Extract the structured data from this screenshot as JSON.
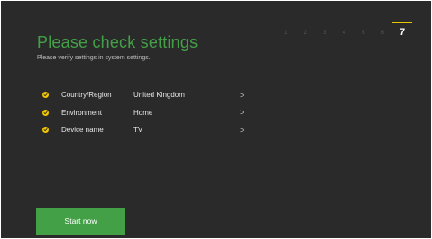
{
  "header": {
    "title": "Please check settings",
    "subtitle": "Please verify settings in system settings."
  },
  "steps": {
    "items": [
      "1",
      "2",
      "3",
      "4",
      "5",
      "6",
      "7"
    ],
    "current": "7",
    "accent_color": "#e6c700"
  },
  "settings": [
    {
      "label": "Country/Region",
      "value": "United Kingdom",
      "chevron": ">"
    },
    {
      "label": "Environment",
      "value": "Home",
      "chevron": ">"
    },
    {
      "label": "Device name",
      "value": "TV",
      "chevron": ">"
    }
  ],
  "actions": {
    "start_label": "Start now"
  },
  "colors": {
    "background": "#2a2a2a",
    "accent_green": "#43a047",
    "check_yellow": "#f2c600"
  },
  "icons": {
    "check": "check-circle-icon",
    "chevron": "chevron-right-icon"
  }
}
